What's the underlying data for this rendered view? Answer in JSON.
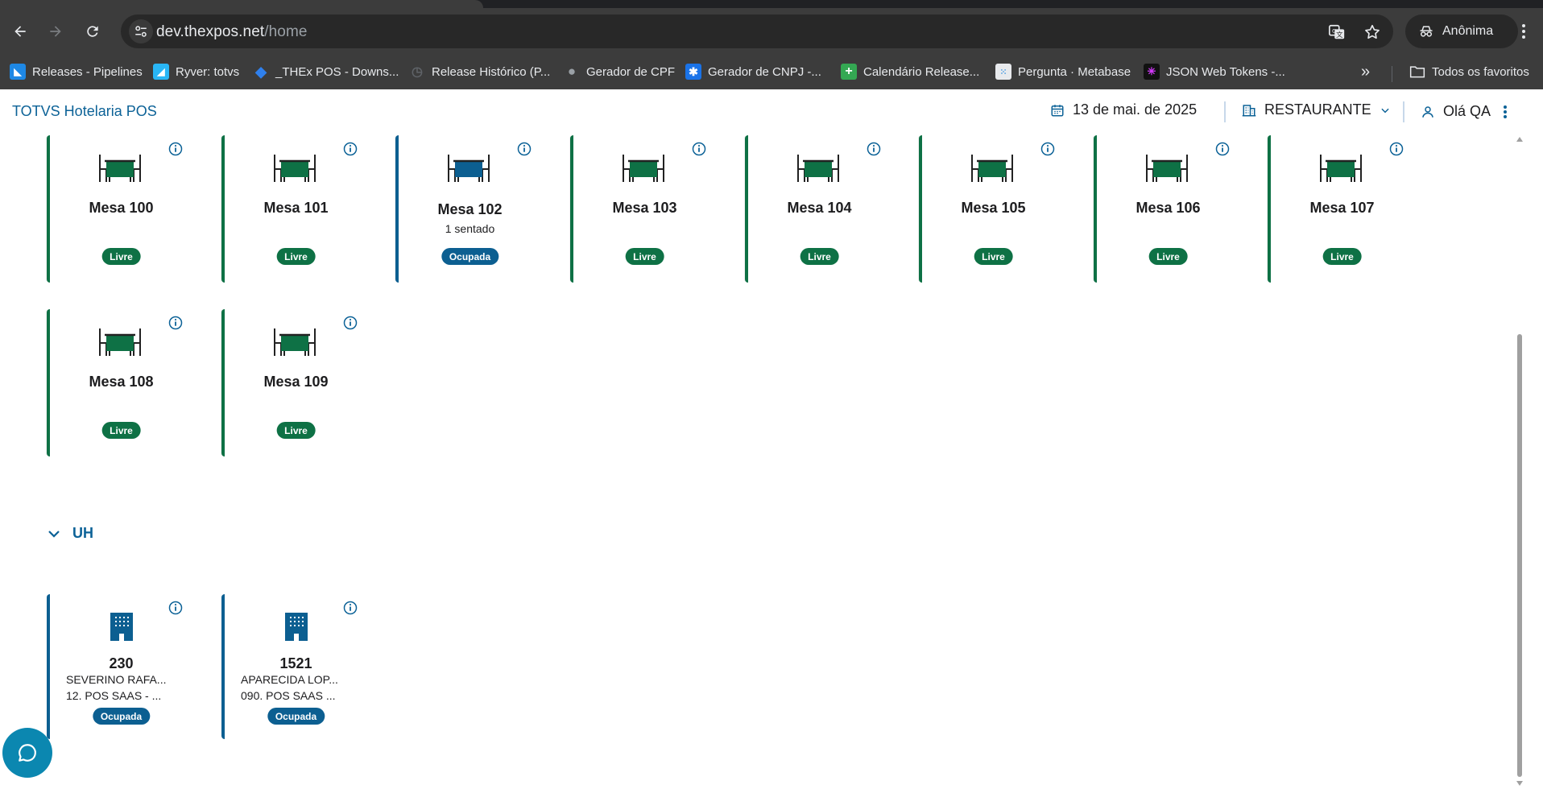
{
  "browser": {
    "url_host": "dev.thexpos.net",
    "url_path": "/home",
    "profile_label": "Anônima",
    "bookmarks": [
      {
        "label": "Releases - Pipelines",
        "icon": "azure-devops-icon",
        "color": "#1e88e5"
      },
      {
        "label": "Ryver: totvs",
        "icon": "ryver-icon",
        "color": "#29b6f6"
      },
      {
        "label": "_THEx POS - Downs...",
        "icon": "diamond-icon",
        "color": "#2f80ed"
      },
      {
        "label": "Release Histórico (P...",
        "icon": "clock-icon",
        "color": "#5f6368"
      },
      {
        "label": "Gerador de CPF",
        "icon": "globe-icon",
        "color": "#9aa0a6"
      },
      {
        "label": "Gerador de CNPJ -...",
        "icon": "gear-icon",
        "color": "#1a73e8"
      },
      {
        "label": "Calendário Release...",
        "icon": "plus-icon",
        "color": "#34a853"
      },
      {
        "label": "Pergunta · Metabase",
        "icon": "metabase-icon",
        "color": "#509ee3"
      },
      {
        "label": "JSON Web Tokens -...",
        "icon": "jwt-icon",
        "color": "#d63aff"
      }
    ],
    "all_bookmarks_label": "Todos os favoritos"
  },
  "header": {
    "brand": "TOTVS Hotelaria POS",
    "date": "13 de mai. de 2025",
    "location": "RESTAURANTE",
    "greeting": "Olá QA"
  },
  "colors": {
    "brand_blue": "#0c6297",
    "free_green": "#0e7145",
    "occupied_blue": "#0c5f91"
  },
  "tables": [
    {
      "name": "Mesa 100",
      "status": "Livre",
      "subtitle": ""
    },
    {
      "name": "Mesa 101",
      "status": "Livre",
      "subtitle": ""
    },
    {
      "name": "Mesa 102",
      "status": "Ocupada",
      "subtitle": "1 sentado"
    },
    {
      "name": "Mesa 103",
      "status": "Livre",
      "subtitle": ""
    },
    {
      "name": "Mesa 104",
      "status": "Livre",
      "subtitle": ""
    },
    {
      "name": "Mesa 105",
      "status": "Livre",
      "subtitle": ""
    },
    {
      "name": "Mesa 106",
      "status": "Livre",
      "subtitle": ""
    },
    {
      "name": "Mesa 107",
      "status": "Livre",
      "subtitle": ""
    },
    {
      "name": "Mesa 108",
      "status": "Livre",
      "subtitle": ""
    },
    {
      "name": "Mesa 109",
      "status": "Livre",
      "subtitle": ""
    }
  ],
  "uh_section": {
    "title": "UH",
    "rooms": [
      {
        "number": "230",
        "guest": "SEVERINO RAFA...",
        "account": "12. POS SAAS - ...",
        "status": "Ocupada"
      },
      {
        "number": "1521",
        "guest": "APARECIDA LOP...",
        "account": "090. POS SAAS ...",
        "status": "Ocupada"
      }
    ]
  }
}
